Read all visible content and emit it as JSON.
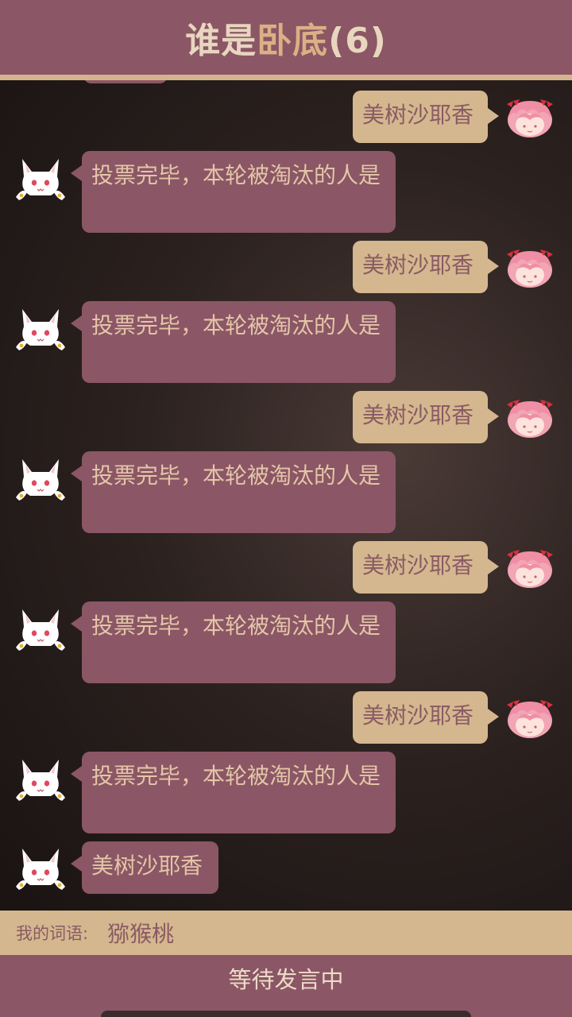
{
  "header": {
    "title_part1": "谁是",
    "title_highlight": "卧底",
    "title_count": "(6)"
  },
  "messages": [
    {
      "side": "self",
      "text": "美树沙耶香",
      "avatar": "madoka-avatar-icon"
    },
    {
      "side": "other",
      "text": "投票完毕，本轮被淘汰的人是",
      "avatar": "kyubey-avatar-icon"
    },
    {
      "side": "self",
      "text": "美树沙耶香",
      "avatar": "madoka-avatar-icon"
    },
    {
      "side": "other",
      "text": "投票完毕，本轮被淘汰的人是",
      "avatar": "kyubey-avatar-icon"
    },
    {
      "side": "self",
      "text": "美树沙耶香",
      "avatar": "madoka-avatar-icon"
    },
    {
      "side": "other",
      "text": "投票完毕，本轮被淘汰的人是",
      "avatar": "kyubey-avatar-icon"
    },
    {
      "side": "self",
      "text": "美树沙耶香",
      "avatar": "madoka-avatar-icon"
    },
    {
      "side": "other",
      "text": "投票完毕，本轮被淘汰的人是",
      "avatar": "kyubey-avatar-icon"
    },
    {
      "side": "self",
      "text": "美树沙耶香",
      "avatar": "madoka-avatar-icon"
    },
    {
      "side": "other",
      "text": "投票完毕，本轮被淘汰的人是",
      "avatar": "kyubey-avatar-icon"
    },
    {
      "side": "other",
      "text": "美树沙耶香",
      "avatar": "kyubey-avatar-icon"
    }
  ],
  "word_bar": {
    "label": "我的词语:",
    "value": "猕猴桃"
  },
  "footer": {
    "status": "等待发言中"
  },
  "colors": {
    "primary": "#8b5665",
    "accent": "#d4b78e",
    "highlight": "#d9b185"
  }
}
